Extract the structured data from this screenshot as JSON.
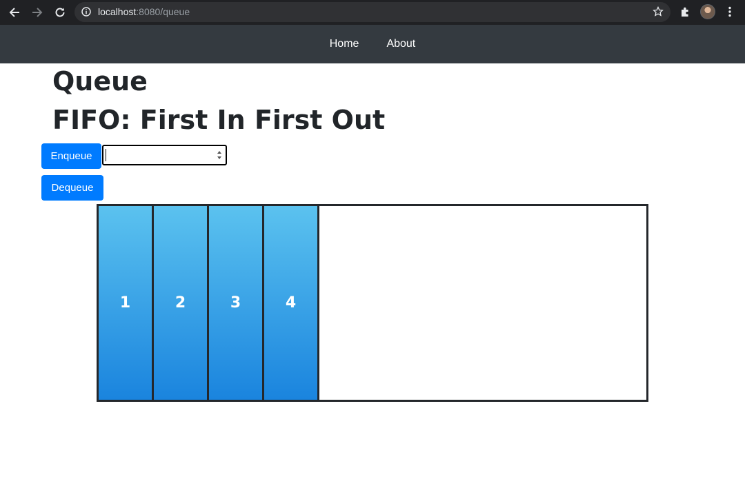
{
  "browser": {
    "url_host": "localhost",
    "url_rest": ":8080/queue"
  },
  "navbar": {
    "links": [
      "Home",
      "About"
    ]
  },
  "page": {
    "title": "Queue",
    "subtitle": "FIFO: First In First Out"
  },
  "controls": {
    "enqueue_label": "Enqueue",
    "dequeue_label": "Dequeue",
    "input_value": ""
  },
  "queue": {
    "items": [
      "1",
      "2",
      "3",
      "4"
    ]
  },
  "colors": {
    "navbar_bg": "#343a40",
    "button_primary": "#007bff",
    "cell_gradient_top": "#5bc2ef",
    "cell_gradient_bottom": "#1a84de"
  }
}
